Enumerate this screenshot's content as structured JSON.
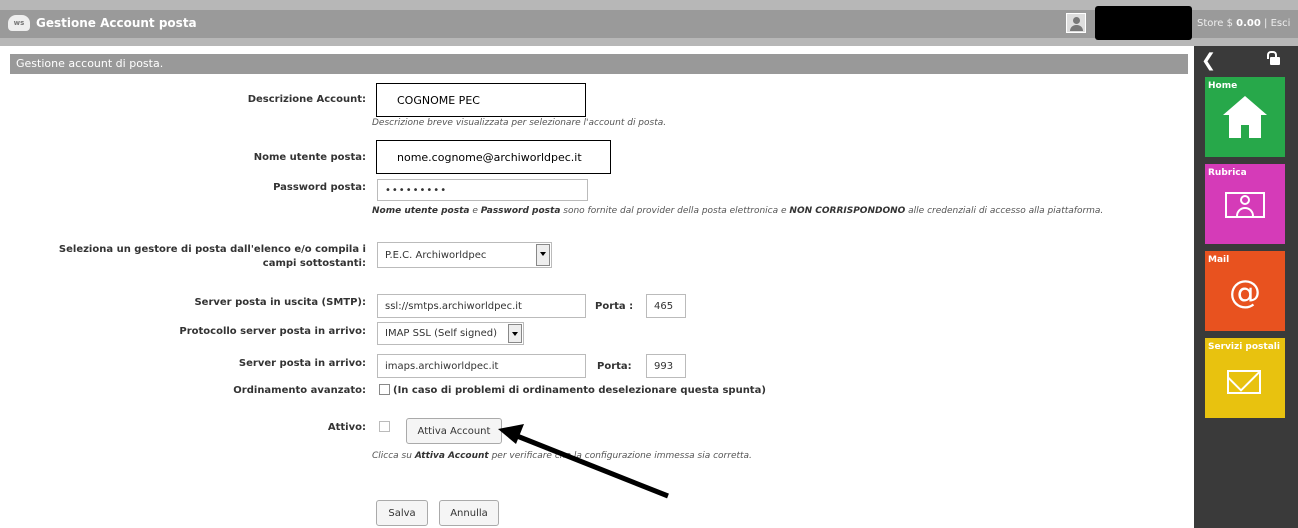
{
  "header": {
    "logo_text": "ws",
    "title": "Gestione Account posta",
    "store_label": "Store $",
    "store_amount": "0.00",
    "store_sep": "|",
    "logout": "Esci"
  },
  "section": {
    "title": "Gestione account di posta."
  },
  "form": {
    "desc_label": "Descrizione Account:",
    "desc_value": "COGNOME PEC",
    "desc_hint": "Descrizione breve visualizzata per selezionare l'account di posta.",
    "user_label": "Nome utente posta:",
    "user_value": "nome.cognome@archiworldpec.it",
    "pwd_label": "Password posta:",
    "pwd_value": "•••••••••",
    "cred_hint_b1": "Nome utente posta",
    "cred_hint_t1": " e ",
    "cred_hint_b2": "Password posta",
    "cred_hint_t2": " sono fornite dal provider della posta elettronica e ",
    "cred_hint_b3": "NON CORRISPONDONO",
    "cred_hint_t3": " alle credenziali di accesso alla piattaforma.",
    "provider_label": "Seleziona un gestore di posta dall'elenco e/o compila i campi sottostanti:",
    "provider_value": "P.E.C. Archiworldpec",
    "smtp_label": "Server posta in uscita (SMTP):",
    "smtp_value": "ssl://smtps.archiworldpec.it",
    "smtp_port_label": "Porta :",
    "smtp_port_value": "465",
    "proto_label": "Protocollo server posta in arrivo:",
    "proto_value": "IMAP SSL (Self signed)",
    "in_label": "Server posta in arrivo:",
    "in_value": "imaps.archiworldpec.it",
    "in_port_label": "Porta:",
    "in_port_value": "993",
    "sort_label": "Ordinamento avanzato:",
    "sort_note": "(In caso di problemi di ordinamento deselezionare questa spunta)",
    "active_label": "Attivo:",
    "activate_button": "Attiva Account",
    "activate_hint_t1": "Clicca su ",
    "activate_hint_b1": "Attiva Account",
    "activate_hint_t2": " per verificare che la configurazione immessa sia corretta.",
    "save_button": "Salva",
    "cancel_button": "Annulla"
  },
  "sidebar": {
    "tiles": [
      {
        "label": "Home",
        "color": "#27a84a",
        "icon": "home-icon"
      },
      {
        "label": "Rubrica",
        "color": "#d53bb8",
        "icon": "contact-card-icon"
      },
      {
        "label": "Mail",
        "color": "#e8521f",
        "icon": "at-sign-icon"
      },
      {
        "label": "Servizi postali",
        "color": "#e8c20f",
        "icon": "envelope-icon"
      }
    ]
  }
}
